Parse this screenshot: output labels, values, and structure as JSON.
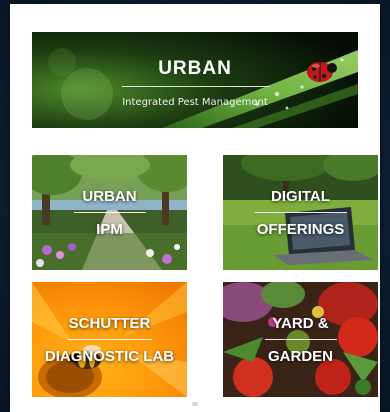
{
  "banner": {
    "title": "URBAN",
    "subtitle": "Integrated Pest Management"
  },
  "tiles": [
    {
      "line1": "URBAN",
      "line2": "IPM"
    },
    {
      "line1": "DIGITAL",
      "line2": "OFFERINGS"
    },
    {
      "line1": "SCHUTTER",
      "line2": "DIAGNOSTIC LAB"
    },
    {
      "line1": "YARD &",
      "line2": "GARDEN"
    }
  ],
  "colors": {
    "page_background": "#0d2036",
    "panel": "#ffffff",
    "label_text": "#ffffff"
  },
  "icons": {
    "banner_image": "ladybug-on-grass-blade",
    "tile_urban_image": "tree-lined-path-with-flowers",
    "tile_digital_image": "laptop-on-lawn",
    "tile_schutter_image": "bee-on-yellow-flower",
    "tile_yard_image": "tomatoes-and-garden-produce"
  }
}
